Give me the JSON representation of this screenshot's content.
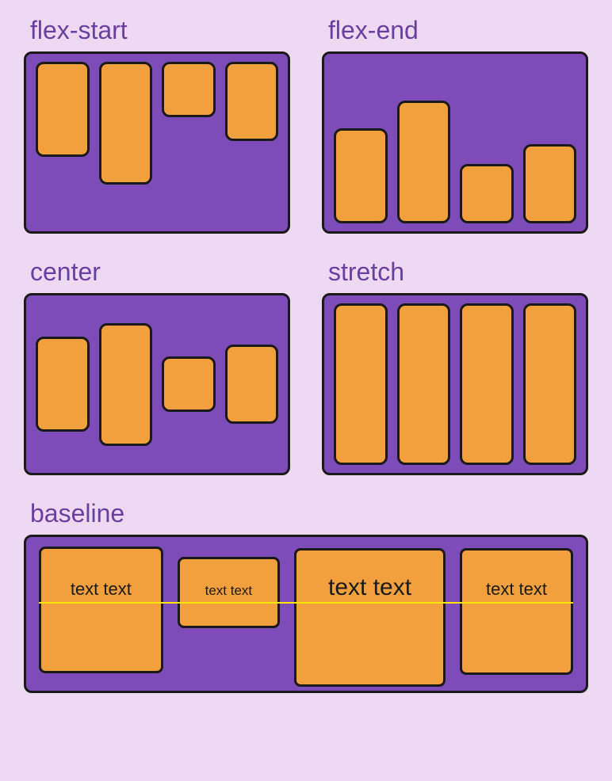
{
  "sections": {
    "flexStart": {
      "label": "flex-start"
    },
    "flexEnd": {
      "label": "flex-end"
    },
    "center": {
      "label": "center"
    },
    "stretch": {
      "label": "stretch"
    },
    "baseline": {
      "label": "baseline"
    }
  },
  "baselineItems": {
    "a": "text text",
    "b": "text text",
    "c": "text text",
    "d": "text text"
  },
  "colors": {
    "background": "#eed9f2",
    "container": "#7e4cb8",
    "box": "#f2a03d",
    "border": "#1a1a1a",
    "labelText": "#6b3fa0",
    "baselineLine": "#ffe600"
  }
}
